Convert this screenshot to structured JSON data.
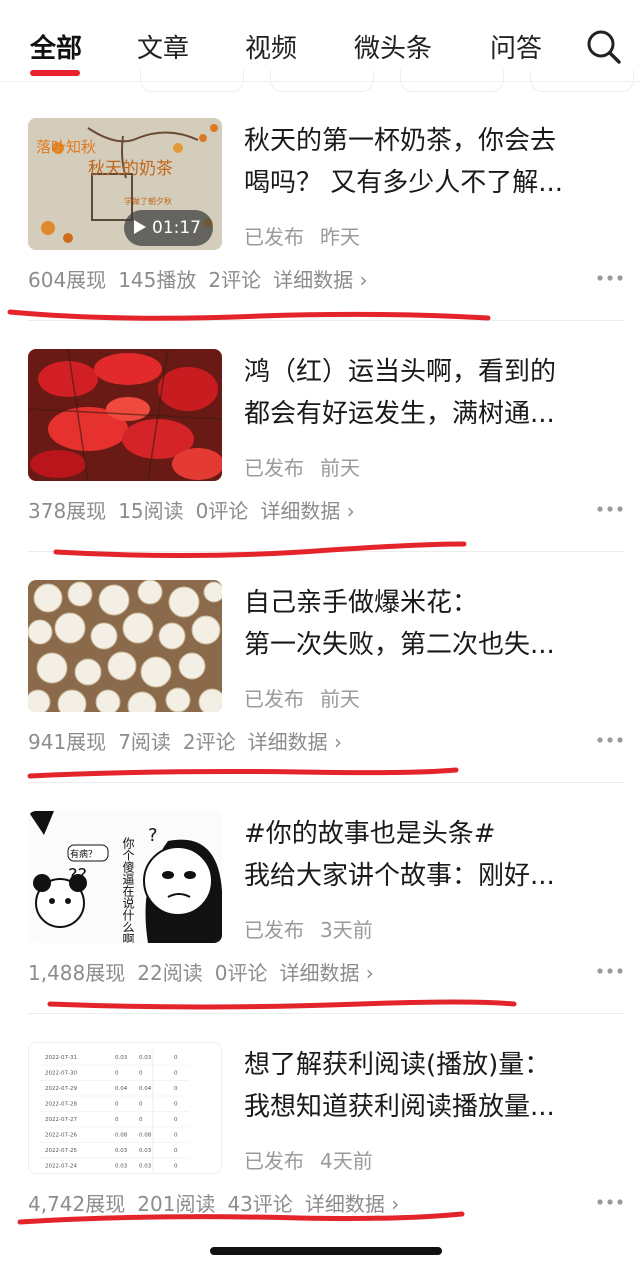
{
  "tabs": [
    {
      "label": "全部",
      "active": true
    },
    {
      "label": "文章",
      "active": false
    },
    {
      "label": "视频",
      "active": false
    },
    {
      "label": "微头条",
      "active": false
    },
    {
      "label": "问答",
      "active": false
    }
  ],
  "search_icon": "search-icon",
  "accent_color": "#e8232f",
  "items": [
    {
      "title_line1": "秋天的第一杯奶茶，你会去",
      "title_line2": "喝吗？ 又有多少人不了解...",
      "status": "已发布",
      "time": "昨天",
      "stat1": "604展现",
      "stat2": "145播放",
      "stat3": "2评论",
      "detail": "详细数据 ›",
      "video_duration": "01:17",
      "thumb_text_1": "秋天的奶茶",
      "thumb_text_2": "落叶知秋",
      "thumb_text_3": "学做了朝夕秋"
    },
    {
      "title_line1": "鸿（红）运当头啊，看到的",
      "title_line2": "都会有好运发生，满树通...",
      "status": "已发布",
      "time": "前天",
      "stat1": "378展现",
      "stat2": "15阅读",
      "stat3": "0评论",
      "detail": "详细数据 ›"
    },
    {
      "title_line1": "自己亲手做爆米花：",
      "title_line2": "第一次失败，第二次也失...",
      "status": "已发布",
      "time": "前天",
      "stat1": "941展现",
      "stat2": "7阅读",
      "stat3": "2评论",
      "detail": "详细数据 ›"
    },
    {
      "title_line1": "#你的故事也是头条#",
      "title_line2": "我给大家讲个故事：刚好...",
      "status": "已发布",
      "time": "3天前",
      "stat1": "1,488展现",
      "stat2": "22阅读",
      "stat3": "0评论",
      "detail": "详细数据 ›",
      "meme_text_1": "有病？",
      "meme_text_2": "你个傻逼在说什么啊"
    },
    {
      "title_line1": "想了解获利阅读(播放)量：",
      "title_line2": "我想知道获利阅读播放量...",
      "status": "已发布",
      "time": "4天前",
      "stat1": "4,742展现",
      "stat2": "201阅读",
      "stat3": "43评论",
      "detail": "详细数据 ›",
      "table_dates": [
        "2022-07-31",
        "2022-07-30",
        "2022-07-29",
        "2022-07-28",
        "2022-07-27",
        "2022-07-26",
        "2022-07-25",
        "2022-07-24"
      ],
      "table_col2": [
        "0.03",
        "0",
        "0.04",
        "0",
        "0",
        "0.08",
        "0.03",
        "0.03"
      ],
      "table_col3": [
        "0.03",
        "0",
        "0.04",
        "0",
        "0",
        "0.08",
        "0.03",
        "0.03"
      ],
      "table_col4": [
        "0",
        "0",
        "0",
        "0",
        "0",
        "0",
        "0",
        "0"
      ]
    }
  ]
}
